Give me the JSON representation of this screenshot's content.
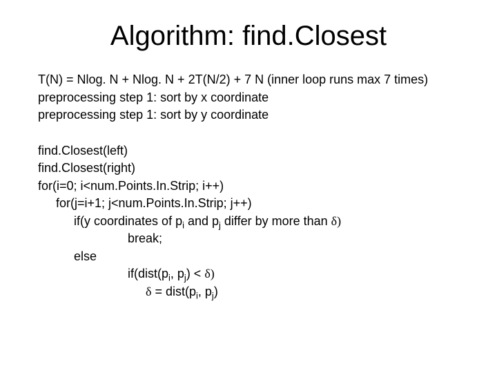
{
  "title": "Algorithm: find.Closest",
  "lines": {
    "recurrence": "T(N) = Nlog. N + Nlog. N + 2T(N/2) + 7 N (inner loop runs max 7 times)",
    "prep1": "preprocessing step 1: sort by x coordinate",
    "prep2": "preprocessing step 1: sort by y coordinate",
    "call_left": "find.Closest(left)",
    "call_right": "find.Closest(right)",
    "for_i": "for(i=0; i<num.Points.In.Strip; i++)",
    "for_j": "for(j=i+1; j<num.Points.In.Strip; j++)",
    "if_y_a": "if(y coordinates of p",
    "if_y_sub_i": "i",
    "if_y_b": " and p",
    "if_y_sub_j": "j",
    "if_y_c": " differ by more than ",
    "delta_paren": "δ)",
    "break": "break;",
    "else": "else",
    "if_dist_a": "if(dist(p",
    "if_dist_sub_i": "i",
    "if_dist_b": ", p",
    "if_dist_sub_j": "j",
    "if_dist_c": ") < ",
    "delta_paren2": "δ)",
    "assign_a": "δ",
    "assign_b": " = dist(p",
    "assign_sub_i": "i",
    "assign_c": ", p",
    "assign_sub_j": "j",
    "assign_d": ")"
  }
}
